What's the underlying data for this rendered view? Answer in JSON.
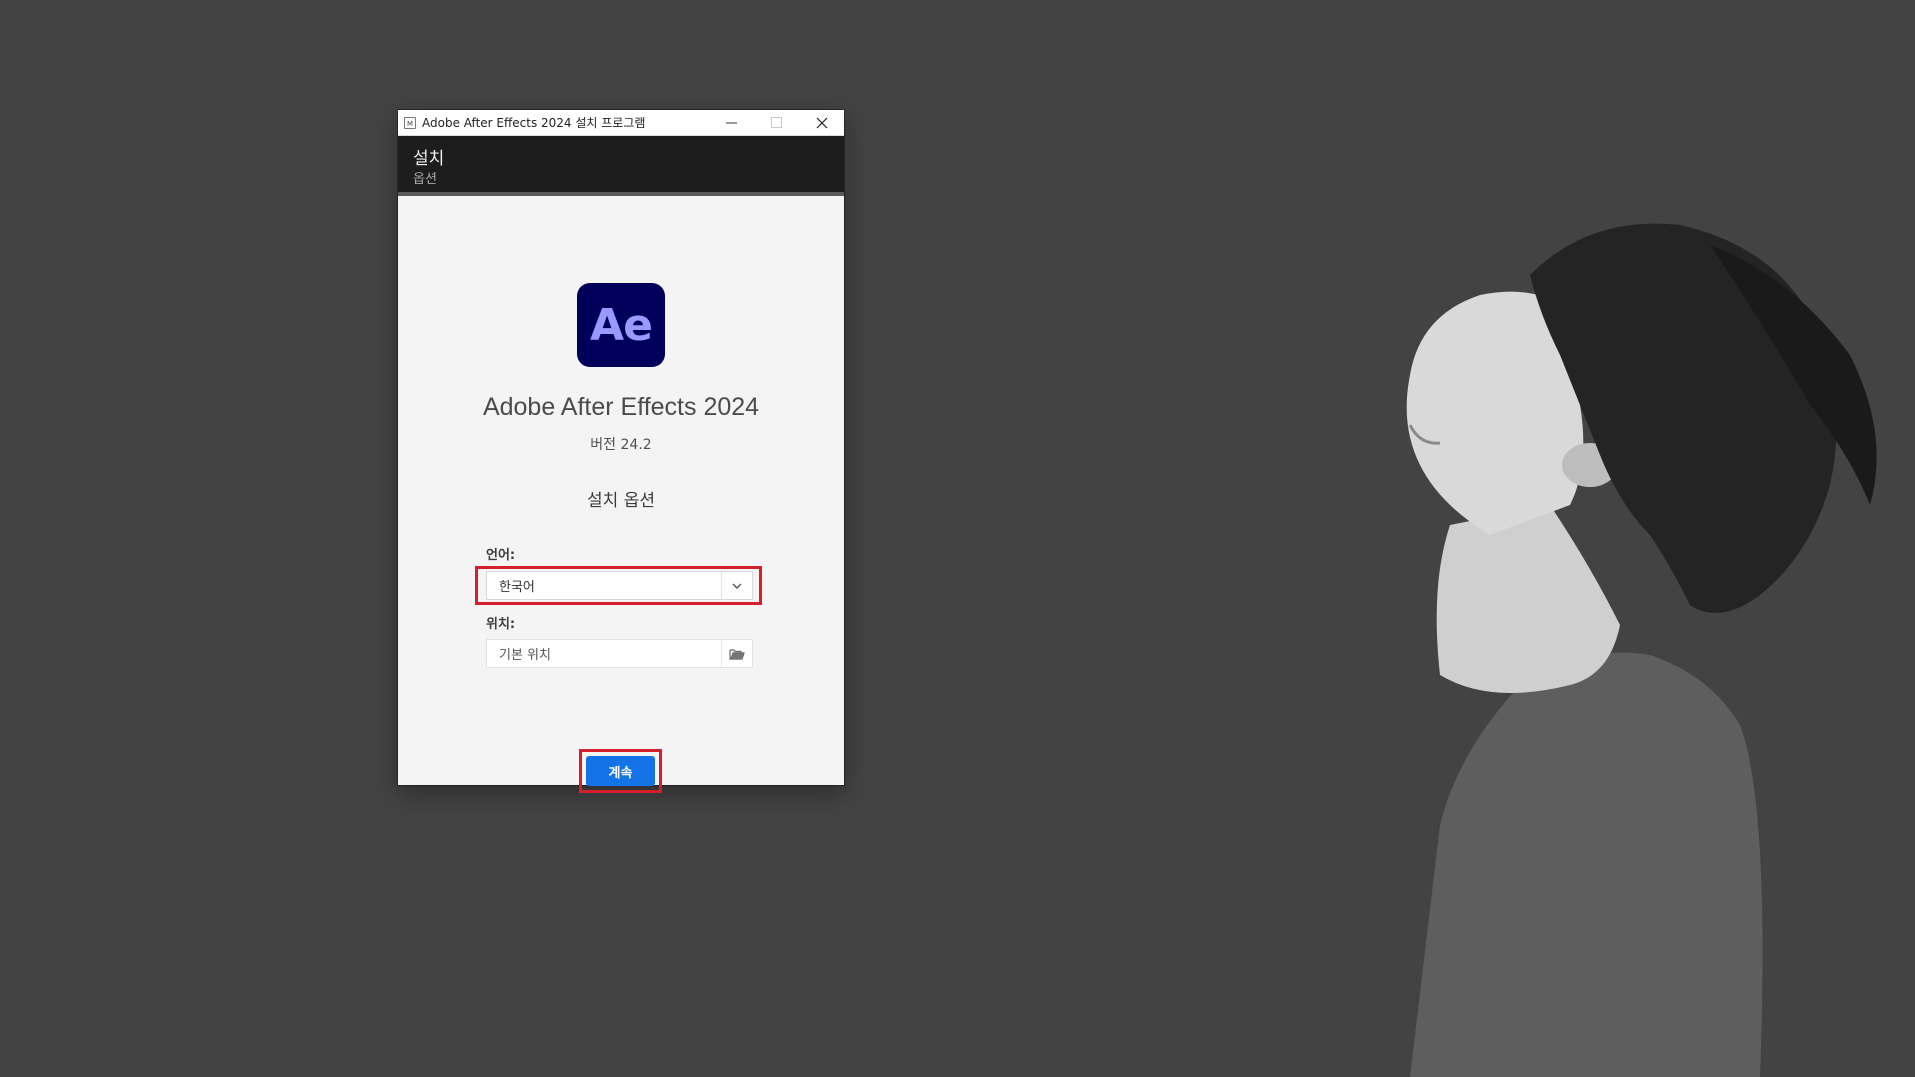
{
  "window": {
    "title": "Adobe After Effects 2024 설치 프로그램",
    "app_icon_letter": "M"
  },
  "header": {
    "title": "설치",
    "subtitle": "옵션"
  },
  "product": {
    "logo_text": "Ae",
    "logo_bg_color": "#00005b",
    "logo_text_color": "#9999ff",
    "name": "Adobe After Effects 2024",
    "version": "버전 24.2"
  },
  "options": {
    "section_title": "설치 옵션",
    "language_label": "언어:",
    "language_value": "한국어",
    "location_label": "위치:",
    "location_value": "기본 위치"
  },
  "actions": {
    "continue_label": "계속",
    "accent_color": "#1473e6"
  },
  "annotations": {
    "highlight_color": "#d3202a"
  },
  "icons": [
    "minimize-icon",
    "maximize-icon",
    "close-icon",
    "chevron-down-icon",
    "folder-icon"
  ]
}
